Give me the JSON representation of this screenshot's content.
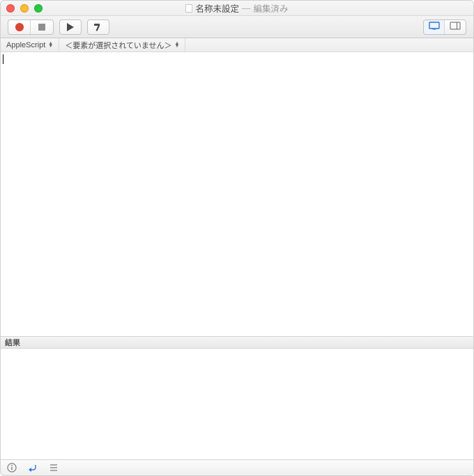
{
  "titlebar": {
    "doc_title": "名称未設定",
    "separator": "—",
    "edited_label": "編集済み"
  },
  "toolbar": {
    "record": "record",
    "stop": "stop",
    "play": "play",
    "build": "build",
    "view_standard": "standard-view",
    "view_accessory": "accessory-view"
  },
  "subbar": {
    "language_label": "AppleScript",
    "element_selector_label": "＜要素が選択されていません＞"
  },
  "editor": {
    "content": ""
  },
  "results": {
    "header_label": "結果",
    "content": ""
  },
  "statusbar": {
    "info": "info",
    "reply": "reply",
    "log": "log"
  }
}
